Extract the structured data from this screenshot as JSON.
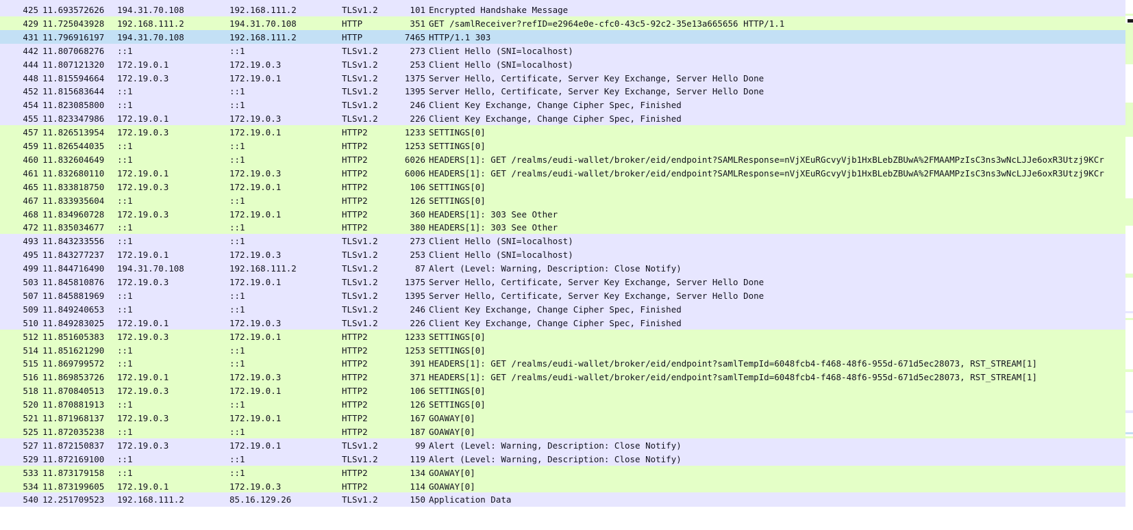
{
  "colors": {
    "tls_row": "#e7e6ff",
    "http_row": "#e4ffc7",
    "selected_row": "#c3e0f5",
    "text": "#12121e",
    "minimap_marker": "#1a1a1a"
  },
  "packets": [
    {
      "no": "425",
      "time": "11.693572626",
      "src": "194.31.70.108",
      "dst": "192.168.111.2",
      "proto": "TLSv1.2",
      "len": "101",
      "info": "Encrypted Handshake Message",
      "kind": "tls"
    },
    {
      "no": "429",
      "time": "11.725043928",
      "src": "192.168.111.2",
      "dst": "194.31.70.108",
      "proto": "HTTP",
      "len": "351",
      "info": "GET /samlReceiver?refID=e2964e0e-cfc0-43c5-92c2-35e13a665656 HTTP/1.1",
      "kind": "http"
    },
    {
      "no": "431",
      "time": "11.796916197",
      "src": "194.31.70.108",
      "dst": "192.168.111.2",
      "proto": "HTTP",
      "len": "7465",
      "info": "HTTP/1.1 303",
      "kind": "selected"
    },
    {
      "no": "442",
      "time": "11.807068276",
      "src": "::1",
      "dst": "::1",
      "proto": "TLSv1.2",
      "len": "273",
      "info": "Client Hello (SNI=localhost)",
      "kind": "tls"
    },
    {
      "no": "444",
      "time": "11.807121320",
      "src": "172.19.0.1",
      "dst": "172.19.0.3",
      "proto": "TLSv1.2",
      "len": "253",
      "info": "Client Hello (SNI=localhost)",
      "kind": "tls"
    },
    {
      "no": "448",
      "time": "11.815594664",
      "src": "172.19.0.3",
      "dst": "172.19.0.1",
      "proto": "TLSv1.2",
      "len": "1375",
      "info": "Server Hello, Certificate, Server Key Exchange, Server Hello Done",
      "kind": "tls"
    },
    {
      "no": "452",
      "time": "11.815683644",
      "src": "::1",
      "dst": "::1",
      "proto": "TLSv1.2",
      "len": "1395",
      "info": "Server Hello, Certificate, Server Key Exchange, Server Hello Done",
      "kind": "tls"
    },
    {
      "no": "454",
      "time": "11.823085800",
      "src": "::1",
      "dst": "::1",
      "proto": "TLSv1.2",
      "len": "246",
      "info": "Client Key Exchange, Change Cipher Spec, Finished",
      "kind": "tls"
    },
    {
      "no": "455",
      "time": "11.823347986",
      "src": "172.19.0.1",
      "dst": "172.19.0.3",
      "proto": "TLSv1.2",
      "len": "226",
      "info": "Client Key Exchange, Change Cipher Spec, Finished",
      "kind": "tls"
    },
    {
      "no": "457",
      "time": "11.826513954",
      "src": "172.19.0.3",
      "dst": "172.19.0.1",
      "proto": "HTTP2",
      "len": "1233",
      "info": "SETTINGS[0]",
      "kind": "http"
    },
    {
      "no": "459",
      "time": "11.826544035",
      "src": "::1",
      "dst": "::1",
      "proto": "HTTP2",
      "len": "1253",
      "info": "SETTINGS[0]",
      "kind": "http"
    },
    {
      "no": "460",
      "time": "11.832604649",
      "src": "::1",
      "dst": "::1",
      "proto": "HTTP2",
      "len": "6026",
      "info": "HEADERS[1]: GET /realms/eudi-wallet/broker/eid/endpoint?SAMLResponse=nVjXEuRGcvyVjb1HxBLebZBUwA%2FMAAMPzIsC3ns3wNcLJJe6oxR3Utzj9KCr",
      "kind": "http"
    },
    {
      "no": "461",
      "time": "11.832680110",
      "src": "172.19.0.1",
      "dst": "172.19.0.3",
      "proto": "HTTP2",
      "len": "6006",
      "info": "HEADERS[1]: GET /realms/eudi-wallet/broker/eid/endpoint?SAMLResponse=nVjXEuRGcvyVjb1HxBLebZBUwA%2FMAAMPzIsC3ns3wNcLJJe6oxR3Utzj9KCr",
      "kind": "http"
    },
    {
      "no": "465",
      "time": "11.833818750",
      "src": "172.19.0.3",
      "dst": "172.19.0.1",
      "proto": "HTTP2",
      "len": "106",
      "info": "SETTINGS[0]",
      "kind": "http"
    },
    {
      "no": "467",
      "time": "11.833935604",
      "src": "::1",
      "dst": "::1",
      "proto": "HTTP2",
      "len": "126",
      "info": "SETTINGS[0]",
      "kind": "http"
    },
    {
      "no": "468",
      "time": "11.834960728",
      "src": "172.19.0.3",
      "dst": "172.19.0.1",
      "proto": "HTTP2",
      "len": "360",
      "info": "HEADERS[1]: 303 See Other",
      "kind": "http"
    },
    {
      "no": "472",
      "time": "11.835034677",
      "src": "::1",
      "dst": "::1",
      "proto": "HTTP2",
      "len": "380",
      "info": "HEADERS[1]: 303 See Other",
      "kind": "http"
    },
    {
      "no": "493",
      "time": "11.843233556",
      "src": "::1",
      "dst": "::1",
      "proto": "TLSv1.2",
      "len": "273",
      "info": "Client Hello (SNI=localhost)",
      "kind": "tls"
    },
    {
      "no": "495",
      "time": "11.843277237",
      "src": "172.19.0.1",
      "dst": "172.19.0.3",
      "proto": "TLSv1.2",
      "len": "253",
      "info": "Client Hello (SNI=localhost)",
      "kind": "tls"
    },
    {
      "no": "499",
      "time": "11.844716490",
      "src": "194.31.70.108",
      "dst": "192.168.111.2",
      "proto": "TLSv1.2",
      "len": "87",
      "info": "Alert (Level: Warning, Description: Close Notify)",
      "kind": "tls"
    },
    {
      "no": "503",
      "time": "11.845810876",
      "src": "172.19.0.3",
      "dst": "172.19.0.1",
      "proto": "TLSv1.2",
      "len": "1375",
      "info": "Server Hello, Certificate, Server Key Exchange, Server Hello Done",
      "kind": "tls"
    },
    {
      "no": "507",
      "time": "11.845881969",
      "src": "::1",
      "dst": "::1",
      "proto": "TLSv1.2",
      "len": "1395",
      "info": "Server Hello, Certificate, Server Key Exchange, Server Hello Done",
      "kind": "tls"
    },
    {
      "no": "509",
      "time": "11.849240653",
      "src": "::1",
      "dst": "::1",
      "proto": "TLSv1.2",
      "len": "246",
      "info": "Client Key Exchange, Change Cipher Spec, Finished",
      "kind": "tls"
    },
    {
      "no": "510",
      "time": "11.849283025",
      "src": "172.19.0.1",
      "dst": "172.19.0.3",
      "proto": "TLSv1.2",
      "len": "226",
      "info": "Client Key Exchange, Change Cipher Spec, Finished",
      "kind": "tls"
    },
    {
      "no": "512",
      "time": "11.851605383",
      "src": "172.19.0.3",
      "dst": "172.19.0.1",
      "proto": "HTTP2",
      "len": "1233",
      "info": "SETTINGS[0]",
      "kind": "http"
    },
    {
      "no": "514",
      "time": "11.851621290",
      "src": "::1",
      "dst": "::1",
      "proto": "HTTP2",
      "len": "1253",
      "info": "SETTINGS[0]",
      "kind": "http"
    },
    {
      "no": "515",
      "time": "11.869799572",
      "src": "::1",
      "dst": "::1",
      "proto": "HTTP2",
      "len": "391",
      "info": "HEADERS[1]: GET /realms/eudi-wallet/broker/eid/endpoint?samlTempId=6048fcb4-f468-48f6-955d-671d5ec28073, RST_STREAM[1]",
      "kind": "http"
    },
    {
      "no": "516",
      "time": "11.869853726",
      "src": "172.19.0.1",
      "dst": "172.19.0.3",
      "proto": "HTTP2",
      "len": "371",
      "info": "HEADERS[1]: GET /realms/eudi-wallet/broker/eid/endpoint?samlTempId=6048fcb4-f468-48f6-955d-671d5ec28073, RST_STREAM[1]",
      "kind": "http"
    },
    {
      "no": "518",
      "time": "11.870840513",
      "src": "172.19.0.3",
      "dst": "172.19.0.1",
      "proto": "HTTP2",
      "len": "106",
      "info": "SETTINGS[0]",
      "kind": "http"
    },
    {
      "no": "520",
      "time": "11.870881913",
      "src": "::1",
      "dst": "::1",
      "proto": "HTTP2",
      "len": "126",
      "info": "SETTINGS[0]",
      "kind": "http"
    },
    {
      "no": "521",
      "time": "11.871968137",
      "src": "172.19.0.3",
      "dst": "172.19.0.1",
      "proto": "HTTP2",
      "len": "167",
      "info": "GOAWAY[0]",
      "kind": "http"
    },
    {
      "no": "525",
      "time": "11.872035238",
      "src": "::1",
      "dst": "::1",
      "proto": "HTTP2",
      "len": "187",
      "info": "GOAWAY[0]",
      "kind": "http"
    },
    {
      "no": "527",
      "time": "11.872150837",
      "src": "172.19.0.3",
      "dst": "172.19.0.1",
      "proto": "TLSv1.2",
      "len": "99",
      "info": "Alert (Level: Warning, Description: Close Notify)",
      "kind": "tls"
    },
    {
      "no": "529",
      "time": "11.872169100",
      "src": "::1",
      "dst": "::1",
      "proto": "TLSv1.2",
      "len": "119",
      "info": "Alert (Level: Warning, Description: Close Notify)",
      "kind": "tls"
    },
    {
      "no": "533",
      "time": "11.873179158",
      "src": "::1",
      "dst": "::1",
      "proto": "HTTP2",
      "len": "134",
      "info": "GOAWAY[0]",
      "kind": "http"
    },
    {
      "no": "534",
      "time": "11.873199605",
      "src": "172.19.0.1",
      "dst": "172.19.0.3",
      "proto": "HTTP2",
      "len": "114",
      "info": "GOAWAY[0]",
      "kind": "http"
    },
    {
      "no": "540",
      "time": "12.251709523",
      "src": "192.168.111.2",
      "dst": "85.16.129.26",
      "proto": "TLSv1.2",
      "len": "150",
      "info": "Application Data",
      "kind": "tls"
    }
  ]
}
